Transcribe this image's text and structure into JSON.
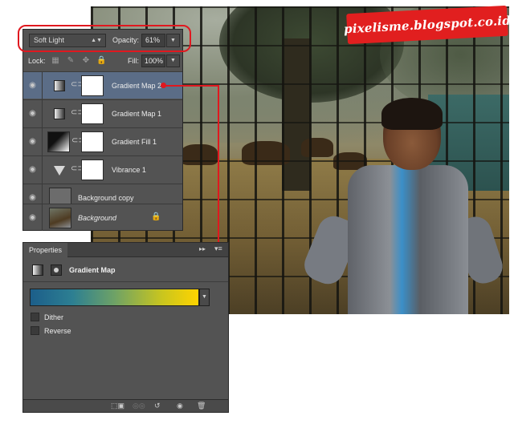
{
  "watermark": "pixelisme.blogspot.co.id",
  "layers_panel": {
    "blend_mode": "Soft Light",
    "opacity_label": "Opacity:",
    "opacity_value": "61%",
    "lock_label": "Lock:",
    "fill_label": "Fill:",
    "fill_value": "100%",
    "layers": [
      {
        "name": "Gradient Map 2",
        "selected": true
      },
      {
        "name": "Gradient Map 1",
        "selected": false
      },
      {
        "name": "Gradient Fill 1",
        "selected": false
      },
      {
        "name": "Vibrance 1",
        "selected": false
      },
      {
        "name": "Background copy",
        "selected": false
      },
      {
        "name": "Background",
        "selected": false
      }
    ]
  },
  "properties_panel": {
    "tab_label": "Properties",
    "title": "Gradient Map",
    "gradient_colors": [
      "#1c5e8a",
      "#ffd400"
    ],
    "options": [
      {
        "label": "Dither",
        "checked": false
      },
      {
        "label": "Reverse",
        "checked": false
      }
    ]
  },
  "colors": {
    "panel_bg": "#535353",
    "selected_row": "#5b6d87",
    "annotation_red": "#e0181f"
  },
  "icons": {
    "eye": "eye-icon",
    "chain": "link-icon",
    "lock": "lock-icon"
  }
}
